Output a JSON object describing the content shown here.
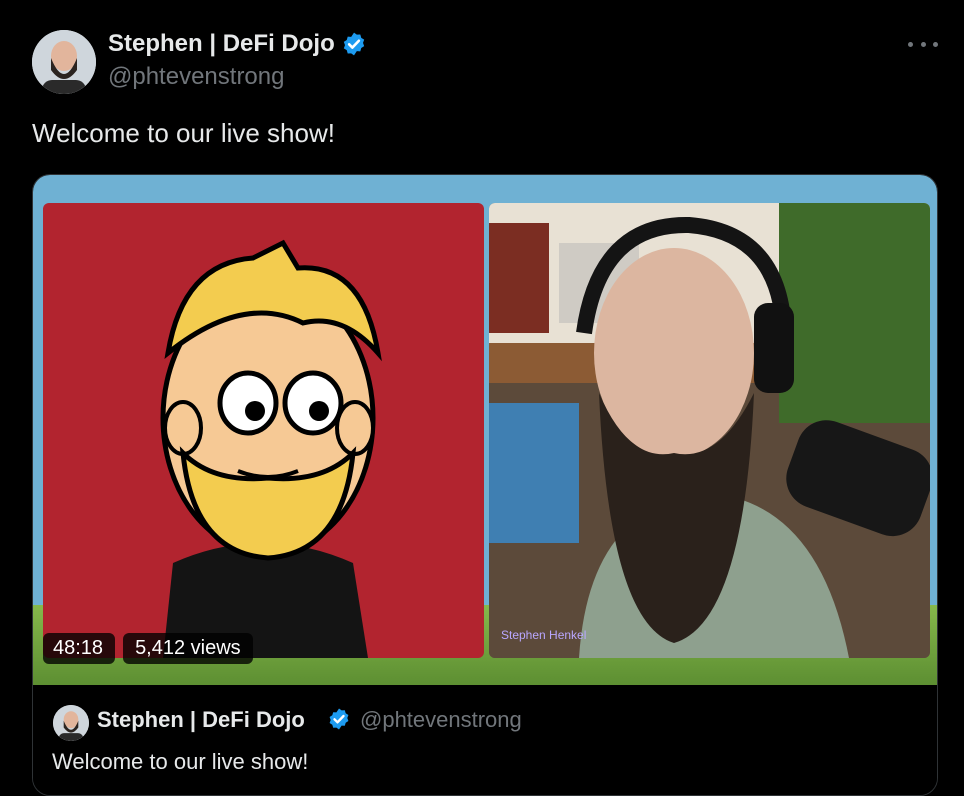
{
  "tweet": {
    "author": {
      "display_name": "Stephen | DeFi Dojo",
      "handle": "@phtevenstrong",
      "verified": true
    },
    "text": "Welcome to our live show!",
    "more_icon": "more-horizontal-icon"
  },
  "media": {
    "duration": "48:18",
    "views": "5,412 views",
    "camera_label": "Stephen Henkel"
  },
  "quoted_tweet": {
    "author": {
      "display_name": "Stephen | DeFi Dojo",
      "handle": "@phtevenstrong",
      "verified": true
    },
    "text": "Welcome to our live show!"
  },
  "colors": {
    "background": "#000000",
    "text": "#e7e9ea",
    "secondary_text": "#71767b",
    "verified_blue": "#1d9bf0",
    "border": "#2f3336"
  }
}
